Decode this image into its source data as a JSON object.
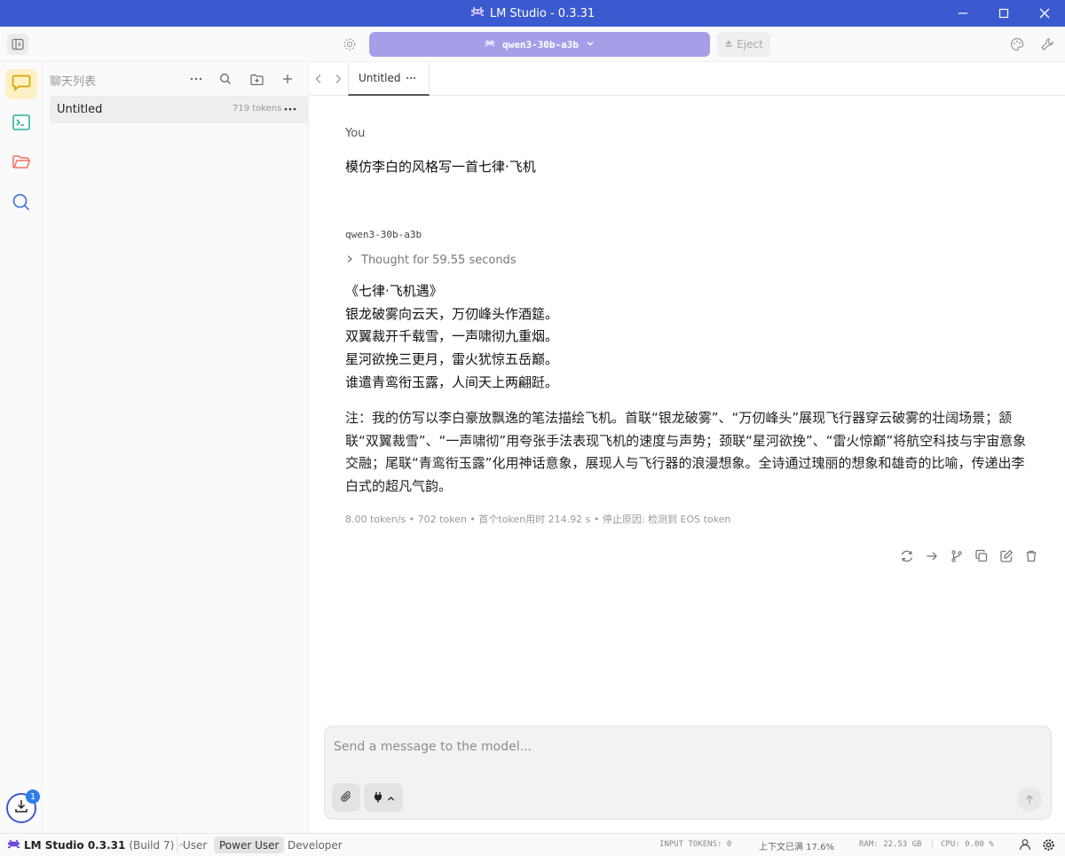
{
  "window": {
    "title": "LM Studio - 0.3.31"
  },
  "toolbar": {
    "model_name": "qwen3-30b-a3b",
    "eject_label": "Eject"
  },
  "sidebar": {
    "title": "聊天列表",
    "chats": [
      {
        "title": "Untitled",
        "tokens": "719 tokens"
      }
    ]
  },
  "tabs": [
    {
      "label": "Untitled"
    }
  ],
  "chat": {
    "user_role": "You",
    "user_message": "模仿李白的风格写一首七律·飞机",
    "model_name": "qwen3-30b-a3b",
    "thought_label": "Thought for 59.55 seconds",
    "poem_lines": [
      "《七律·飞机遇》",
      "银龙破雾向云天，万仞峰头作酒筵。",
      "双翼裁开千载雪，一声啸彻九重烟。",
      "星河欲挽三更月，雷火犹惊五岳巅。",
      "谁遣青鸾衔玉露，人间天上两翩跹。"
    ],
    "note": "注：我的仿写以李白豪放飘逸的笔法描绘飞机。首联“银龙破雾”、“万仞峰头”展现飞行器穿云破雾的壮阔场景；颔联“双翼裁雪”、“一声啸彻”用夸张手法表现飞机的速度与声势；颈联“星河欲挽”、“雷火惊巅”将航空科技与宇宙意象交融；尾联“青鸾衔玉露”化用神话意象，展现人与飞行器的浪漫想象。全诗通过瑰丽的想象和雄奇的比喻，传递出李白式的超凡气韵。",
    "stats": "8.00 token/s • 702 token • 首个token用时 214.92 s • 停止原因: 检测到 EOS token"
  },
  "input": {
    "placeholder": "Send a message to the model..."
  },
  "downloads": {
    "badge": "1"
  },
  "statusbar": {
    "app_name": "LM Studio 0.3.31",
    "build": "(Build 7)",
    "modes": [
      "User",
      "Power User",
      "Developer"
    ],
    "active_mode": "Power User",
    "input_tokens": "INPUT TOKENS: 0",
    "context": "上下文已满 17.6%",
    "ram": "RAM: 22.53 GB",
    "cpu": "CPU: 0.00 %"
  },
  "colors": {
    "titlebar": "#3c5ad0",
    "accent": "#a59fe8",
    "chat_active": "#fdf0c4"
  }
}
